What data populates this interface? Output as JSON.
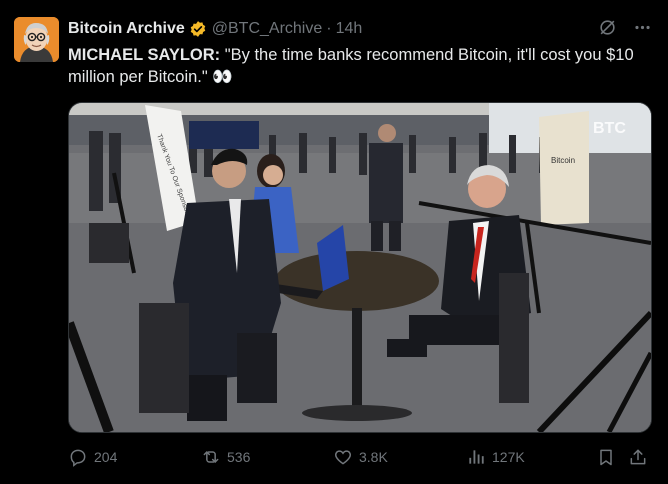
{
  "author": {
    "display_name": "Bitcoin Archive",
    "handle": "@BTC_Archive",
    "separator": "·",
    "time": "14h"
  },
  "tweet": {
    "speaker": "MICHAEL SAYLOR:",
    "quote": " \"By the time banks recommend Bitcoin, it'll cost you $10 million per Bitcoin.\" ",
    "emoji": "👀"
  },
  "media": {
    "sign_text": "Thank You To Our Sponsors",
    "corner_logo": "BTC",
    "stand_text": "Bitcoin"
  },
  "actions": {
    "replies": "204",
    "reposts": "536",
    "likes": "3.8K",
    "views": "127K"
  },
  "icons": {
    "grok": "grok-icon",
    "more": "more-icon",
    "reply": "reply-icon",
    "repost": "repost-icon",
    "like": "heart-icon",
    "views": "views-icon",
    "bookmark": "bookmark-icon",
    "share": "share-icon"
  },
  "colors": {
    "verified": "#f4b928",
    "muted": "#71767b",
    "text": "#e7e9ea",
    "tie": "#c8251e"
  }
}
